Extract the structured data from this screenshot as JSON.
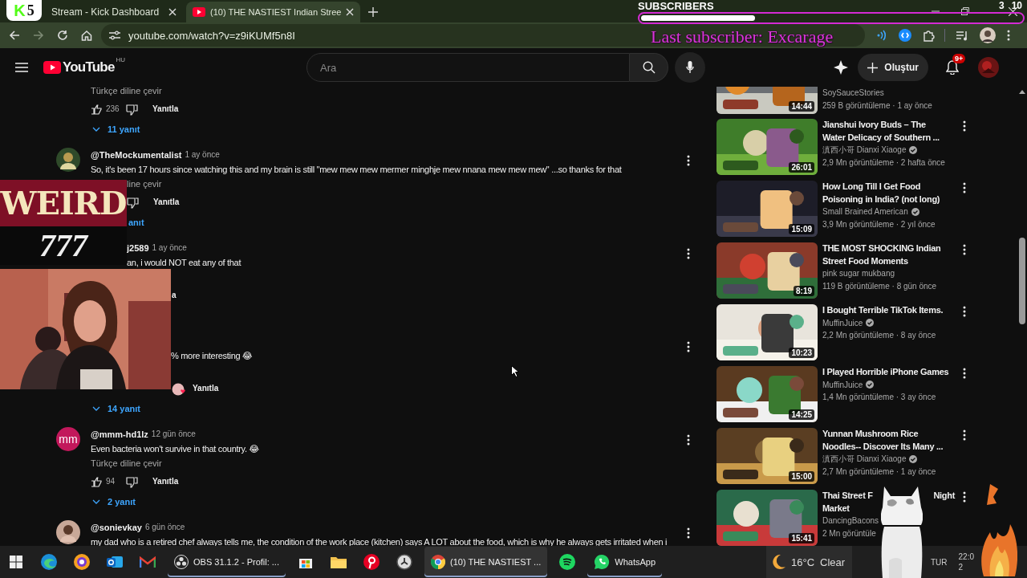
{
  "browser": {
    "tabs": [
      {
        "title": "Stream - Kick Dashboard",
        "selected": false
      },
      {
        "title": "(10) THE NASTIEST Indian Stree",
        "selected": true
      }
    ],
    "url": "youtube.com/watch?v=z9iKUMf5n8I"
  },
  "stream_overlay": {
    "logo_badge": {
      "letter": "K",
      "count": "5"
    },
    "subscribers": {
      "title": "SUBSCRIBERS",
      "level": 0.3,
      "last": "Last subscriber: Excarage",
      "count": "3",
      "goal": "10"
    },
    "banner": {
      "word": "WEIRD",
      "number": "777"
    }
  },
  "youtube": {
    "logo": "YouTube",
    "region": "HU",
    "search": {
      "placeholder": "Ara"
    },
    "create": "Oluştur",
    "notifications": "9+"
  },
  "comments": [
    {
      "kind": "tail",
      "translate": "Türkçe diline çevir",
      "likes": "236",
      "reply": "Yanıtla",
      "hearted": false,
      "replies": "11 yanıt"
    },
    {
      "kind": "under_banner",
      "author": "@TheMockumentalist",
      "time": "1 ay önce",
      "text": "So, it's been 17 hours since watching this and my brain is still \"mew mew mew mermer minghje mew nnana mew mew mew\" ...so thanks for that",
      "translate": "line çevir",
      "reply": "Yanıtla",
      "hearted": false,
      "replies": "anıt"
    },
    {
      "kind": "under_both",
      "author": "j2589",
      "time": "1 ay önce",
      "text": "an, i would NOT eat any of that",
      "reply": "a",
      "hearted": false
    },
    {
      "kind": "under_camera",
      "text": "% more interesting 😂",
      "reply": "Yanıtla",
      "hearted": true,
      "replies": "14 yanıt"
    },
    {
      "kind": "open",
      "initials": "mm",
      "author": "@mmm-hd1lz",
      "time": "12 gün önce",
      "text": "Even bacteria won't survive in that country. 😂",
      "translate": "Türkçe diline çevir",
      "likes": "94",
      "reply": "Yanıtla",
      "hearted": false,
      "replies": "2 yanıt"
    },
    {
      "kind": "open",
      "author": "@sonievkay",
      "time": "6 gün önce",
      "text": "my dad who is a retired chef always tells me, the condition of the work place (kitchen) says A LOT about the food, which is why he always gets irritated when i"
    }
  ],
  "related": [
    {
      "kind": "partial",
      "channel": "SoySauceStories",
      "verified": false,
      "views": "259 B görüntüleme · 1 ay önce",
      "duration": "14:44"
    },
    {
      "kind": "full",
      "title_lines": [
        [
          "Jianshui Ivory Buds – The"
        ],
        [
          "Water Delicacy of Southern ..."
        ]
      ],
      "channel": "滇西小哥 Dianxi Xiaoge",
      "verified": true,
      "views": "2,9 Mn görüntüleme · 2 hafta önce",
      "duration": "26:01"
    },
    {
      "kind": "full",
      "title_lines": [
        [
          "How Long Till I Get Food"
        ],
        [
          "Poisoning in India? (not long)"
        ]
      ],
      "channel": "Small Brained American",
      "verified": true,
      "views": "3,9 Mn görüntüleme · 2 yıl önce",
      "duration": "15:09"
    },
    {
      "kind": "full",
      "title_lines": [
        [
          "THE MOST SHOCKING Indian"
        ],
        [
          "Street Food Moments"
        ]
      ],
      "channel": "pink sugar mukbang",
      "verified": false,
      "views": "119 B görüntüleme · 8 gün önce",
      "duration": "8:19"
    },
    {
      "kind": "full",
      "title_lines": [
        [
          "I Bought Terrible TikTok Items."
        ]
      ],
      "channel": "MuffinJuice",
      "verified": true,
      "views": "2,2 Mn görüntüleme · 8 ay önce",
      "duration": "10:23"
    },
    {
      "kind": "full",
      "title_lines": [
        [
          "I Played Horrible iPhone Games"
        ]
      ],
      "channel": "MuffinJuice",
      "verified": true,
      "views": "1,4 Mn görüntüleme · 3 ay önce",
      "duration": "14:25"
    },
    {
      "kind": "full",
      "title_lines": [
        [
          "Yunnan Mushroom Rice"
        ],
        [
          "Noodles-- Discover Its Many ..."
        ]
      ],
      "channel": "滇西小哥 Dianxi Xiaoge",
      "verified": true,
      "views": "2,7 Mn görüntüleme · 1 ay önce",
      "duration": "15:00"
    },
    {
      "kind": "full",
      "title_lines": [
        [
          "Thai Street F",
          "Night"
        ],
        [
          "Market"
        ]
      ],
      "channel": "DancingBacons",
      "verified": false,
      "views": "2 Mn görüntüle",
      "duration": "15:41"
    }
  ],
  "taskbar": {
    "apps": [
      {
        "kind": "icon",
        "running": false,
        "selected": false
      },
      {
        "kind": "icon",
        "running": false,
        "selected": false
      },
      {
        "kind": "icon",
        "running": false,
        "selected": false
      },
      {
        "kind": "icon",
        "running": false,
        "selected": false
      },
      {
        "kind": "icon",
        "running": false,
        "selected": false
      },
      {
        "kind": "labeled",
        "label": "OBS 31.1.2 - Profil: ...",
        "running": true,
        "selected": false
      },
      {
        "kind": "icon",
        "running": false,
        "selected": false
      },
      {
        "kind": "icon",
        "running": false,
        "selected": false
      },
      {
        "kind": "icon",
        "running": false,
        "selected": false
      },
      {
        "kind": "icon",
        "running": false,
        "selected": false
      },
      {
        "kind": "labeled",
        "label": "(10) THE NASTIEST ...",
        "running": true,
        "selected": true
      },
      {
        "kind": "icon",
        "running": false,
        "selected": false
      },
      {
        "kind": "labeled",
        "label": "WhatsApp",
        "running": true,
        "selected": false
      }
    ],
    "weather": {
      "temp": "16°C",
      "condition": "Clear"
    },
    "language": "TUR",
    "clock": [
      "22:0",
      "2"
    ]
  }
}
